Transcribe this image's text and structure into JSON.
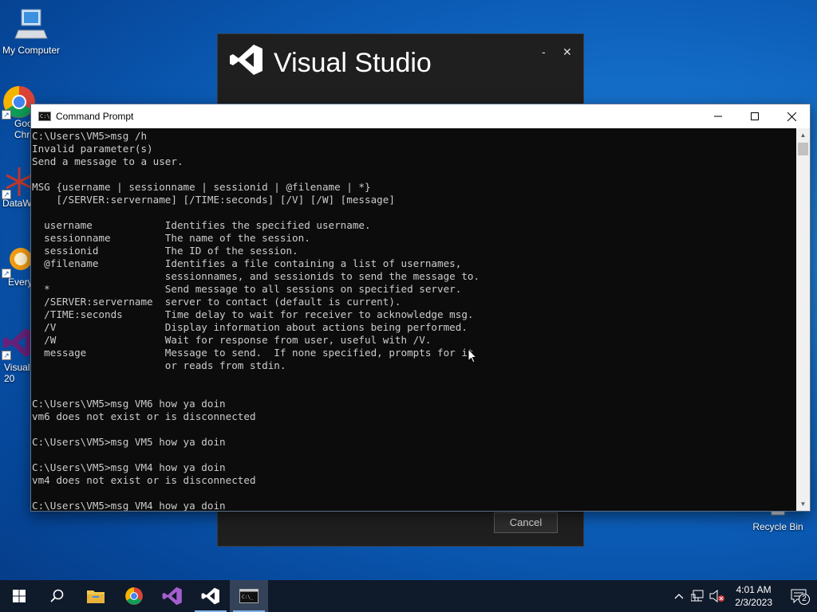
{
  "desktop": {
    "icons": [
      {
        "label": "My Computer"
      },
      {
        "label": "Goo Chr"
      },
      {
        "label": "DataW"
      },
      {
        "label": "Every"
      },
      {
        "label": "Visual 20"
      },
      {
        "label": "Recycle Bin"
      }
    ]
  },
  "vs_splash": {
    "brand": "Visual Studio",
    "minimize_glyph": "-",
    "close_glyph": "✕",
    "cancel_label": "Cancel"
  },
  "cmd": {
    "title": "Command Prompt",
    "lines": [
      "C:\\Users\\VM5>msg /h",
      "Invalid parameter(s)",
      "Send a message to a user.",
      "",
      "MSG {username | sessionname | sessionid | @filename | *}",
      "    [/SERVER:servername] [/TIME:seconds] [/V] [/W] [message]",
      "",
      "  username            Identifies the specified username.",
      "  sessionname         The name of the session.",
      "  sessionid           The ID of the session.",
      "  @filename           Identifies a file containing a list of usernames,",
      "                      sessionnames, and sessionids to send the message to.",
      "  *                   Send message to all sessions on specified server.",
      "  /SERVER:servername  server to contact (default is current).",
      "  /TIME:seconds       Time delay to wait for receiver to acknowledge msg.",
      "  /V                  Display information about actions being performed.",
      "  /W                  Wait for response from user, useful with /V.",
      "  message             Message to send.  If none specified, prompts for it",
      "                      or reads from stdin.",
      "",
      "",
      "C:\\Users\\VM5>msg VM6 how ya doin",
      "vm6 does not exist or is disconnected",
      "",
      "C:\\Users\\VM5>msg VM5 how ya doin",
      "",
      "C:\\Users\\VM5>msg VM4 how ya doin",
      "vm4 does not exist or is disconnected",
      "",
      "C:\\Users\\VM5>msg VM4 how ya doin"
    ]
  },
  "taskbar": {
    "items": [
      {
        "name": "start-button",
        "icon": "windows-logo-icon"
      },
      {
        "name": "search-button",
        "icon": "search-icon"
      },
      {
        "name": "file-explorer",
        "icon": "folder-icon"
      },
      {
        "name": "chrome",
        "icon": "chrome-icon"
      },
      {
        "name": "visual-studio-2019",
        "icon": "visual-studio-purple-icon"
      },
      {
        "name": "visual-studio-installer",
        "icon": "visual-studio-icon"
      },
      {
        "name": "command-prompt",
        "icon": "cmd-icon"
      }
    ],
    "time": "4:01 AM",
    "date": "2/3/2023",
    "notification_count": "2"
  }
}
